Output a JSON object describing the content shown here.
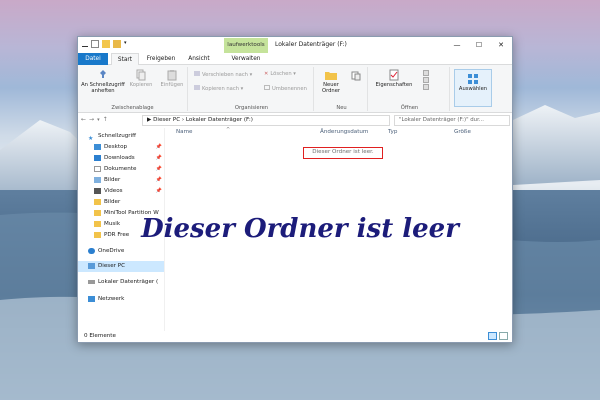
{
  "window": {
    "context_tab": "laufwerktools",
    "title": "Lokaler Datenträger (F:)",
    "controls": {
      "minimize": "—",
      "maximize": "☐",
      "close": "✕"
    }
  },
  "tabs": [
    {
      "label": "Datei"
    },
    {
      "label": "Start"
    },
    {
      "label": "Freigeben"
    },
    {
      "label": "Ansicht"
    },
    {
      "label": "Verwalten"
    }
  ],
  "ribbon": {
    "clipboard": {
      "group_label": "Zwischenablage",
      "pin_label": "An Schnellzugriff anheften",
      "copy_label": "Kopieren",
      "paste_label": "Einfügen"
    },
    "organize": {
      "group_label": "Organisieren",
      "move_label": "Verschieben nach ▾",
      "copy_to_label": "Kopieren nach ▾",
      "delete_label": "Löschen ▾",
      "rename_label": "Umbenennen"
    },
    "new": {
      "group_label": "Neu",
      "new_folder_label": "Neuer Ordner"
    },
    "open": {
      "group_label": "Öffnen",
      "properties_label": "Eigenschaften"
    },
    "select": {
      "select_label": "Auswählen"
    }
  },
  "address_bar": {
    "path": "▶ Dieser PC  ›  Lokaler Datenträger (F:)",
    "search_placeholder": "\"Lokaler Datenträger (F:)\" dur..."
  },
  "nav_pane": {
    "items": [
      {
        "label": "Schnellzugriff",
        "icon": "star-icon",
        "pinned": false
      },
      {
        "label": "Desktop",
        "icon": "desktop-icon",
        "pinned": true
      },
      {
        "label": "Downloads",
        "icon": "download-icon",
        "pinned": true
      },
      {
        "label": "Dokumente",
        "icon": "documents-icon",
        "pinned": true
      },
      {
        "label": "Bilder",
        "icon": "pictures-icon",
        "pinned": true
      },
      {
        "label": "Videos",
        "icon": "videos-icon",
        "pinned": true
      },
      {
        "label": "Bilder",
        "icon": "folder-icon",
        "pinned": false
      },
      {
        "label": "MiniTool Partition W",
        "icon": "folder-icon",
        "pinned": false
      },
      {
        "label": "Musik",
        "icon": "folder-icon",
        "pinned": false
      },
      {
        "label": "PDR Free",
        "icon": "folder-icon",
        "pinned": false
      },
      {
        "label": "OneDrive",
        "icon": "cloud-icon",
        "pinned": false
      },
      {
        "label": "Dieser PC",
        "icon": "computer-icon",
        "pinned": false,
        "selected": true
      },
      {
        "label": "Lokaler Datenträger (",
        "icon": "drive-icon",
        "pinned": false
      },
      {
        "label": "Netzwerk",
        "icon": "network-icon",
        "pinned": false
      }
    ],
    "pin_glyph": "📌"
  },
  "columns": [
    "Name",
    "Änderungsdatum",
    "Typ",
    "Größe"
  ],
  "empty_message": "Dieser Ordner ist leer.",
  "status": {
    "item_count": "0 Elemente"
  },
  "overlay_caption": "Dieser Ordner ist leer",
  "colors": {
    "accent": "#1979ca",
    "context_tab": "#c5e39b",
    "highlight_box": "#e02020",
    "caption": "#1c1c7a",
    "selection": "#cce8ff"
  }
}
